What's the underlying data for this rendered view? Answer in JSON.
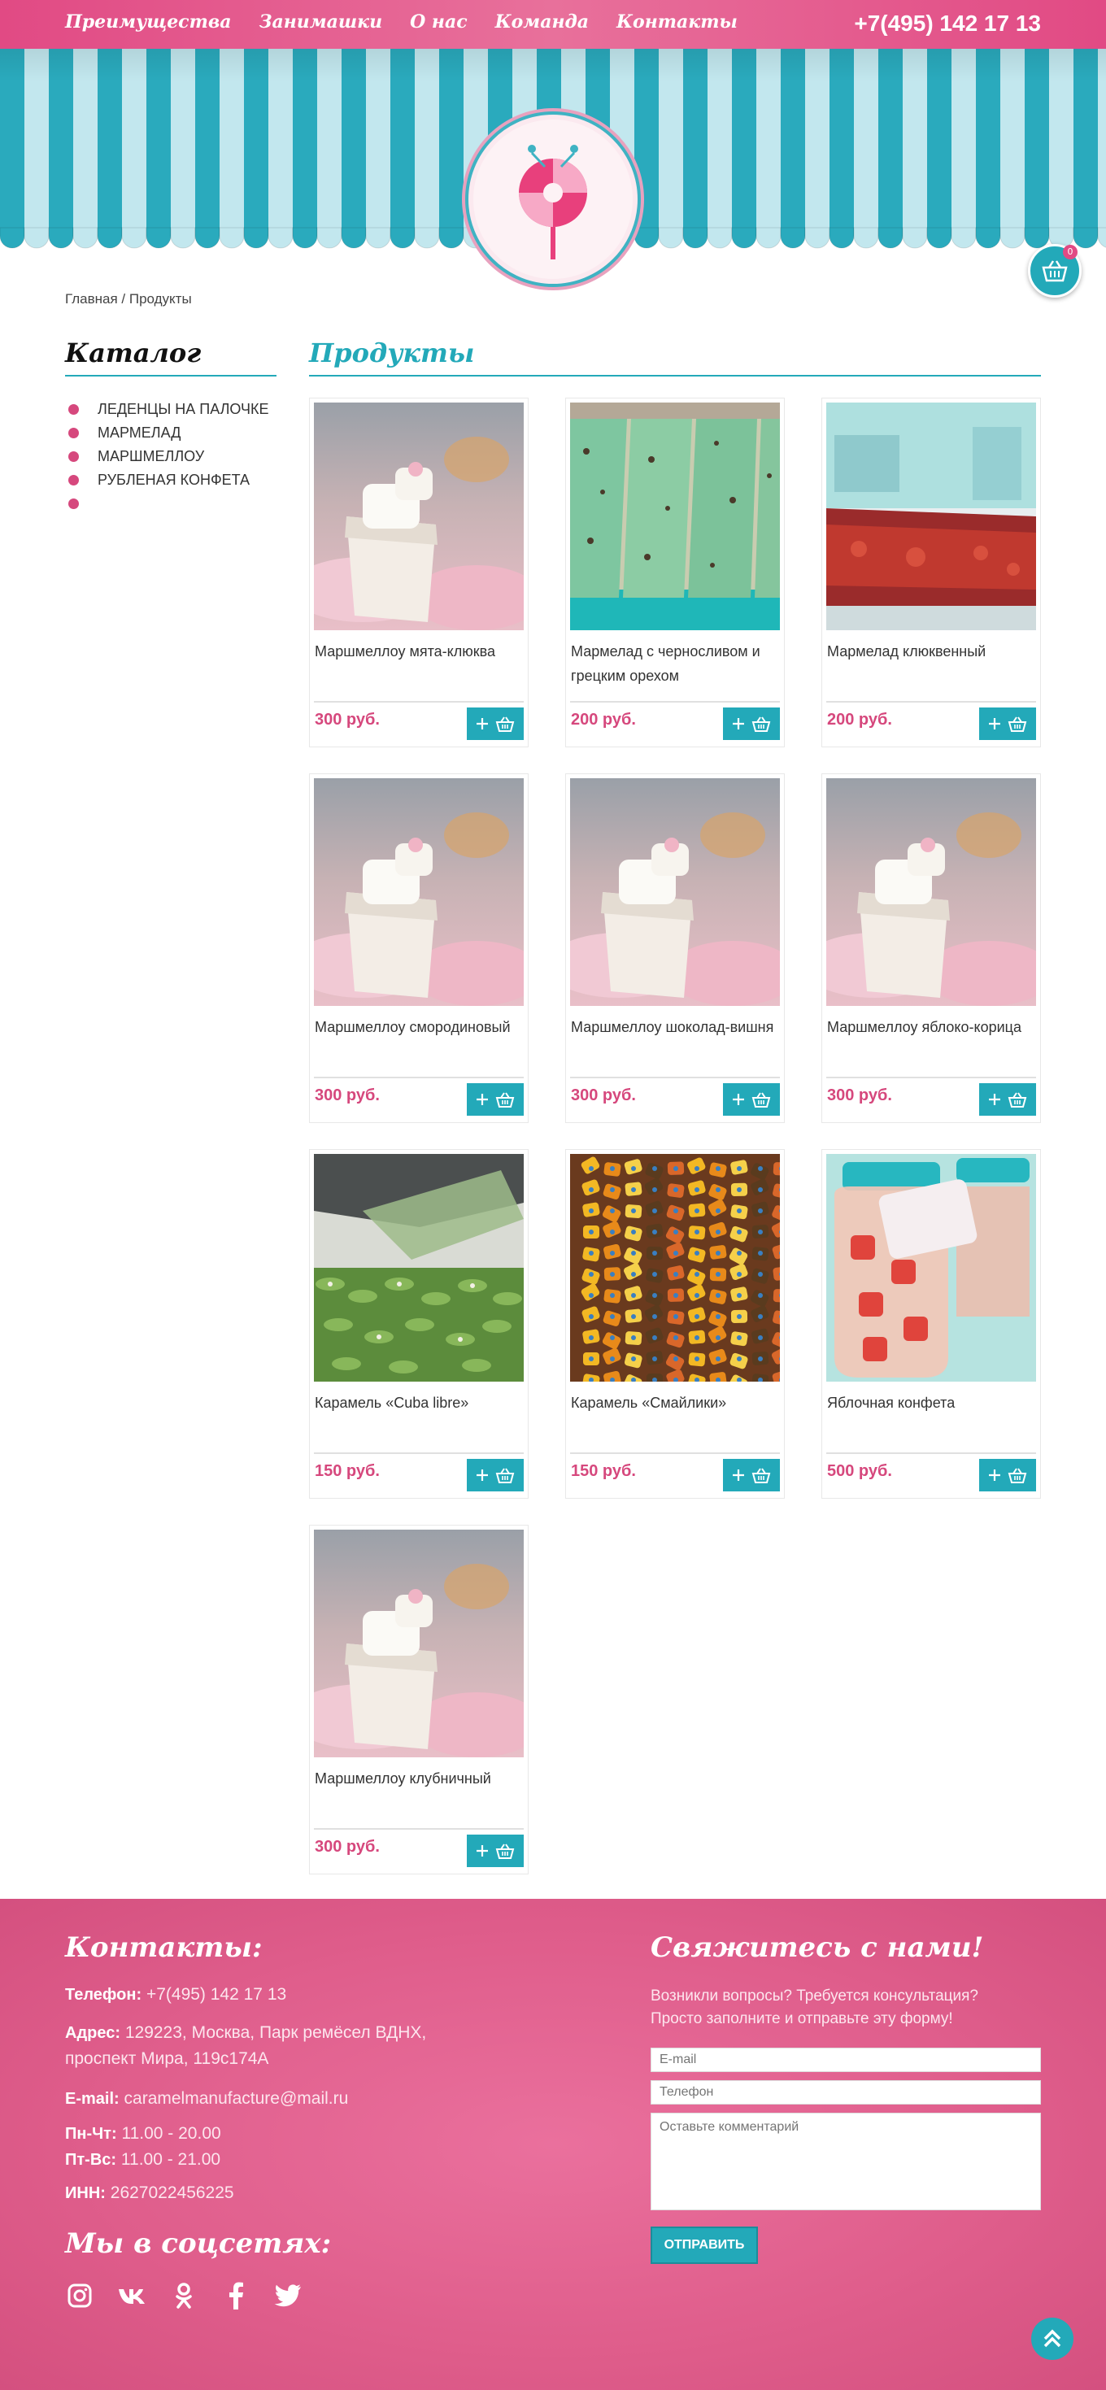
{
  "header": {
    "nav": [
      "Преимущества",
      "Занимашки",
      "О нас",
      "Команда",
      "Контакты"
    ],
    "phone": "+7(495) 142 17 13",
    "cart_count": "0"
  },
  "breadcrumb": "Главная / Продукты",
  "sidebar": {
    "title": "Каталог",
    "items": [
      "ЛЕДЕНЦЫ НА ПАЛОЧКЕ",
      "МАРМЕЛАД",
      "МАРШМЕЛЛОУ",
      "РУБЛЕНАЯ КОНФЕТА",
      ""
    ]
  },
  "main": {
    "title": "Продукты",
    "products": [
      {
        "name": "Маршмеллоу мята-клюква",
        "price": "300 руб.",
        "image": "marshmallow"
      },
      {
        "name": "Мармелад с черносливом и грецким орехом",
        "price": "200 руб.",
        "image": "marmalade-green"
      },
      {
        "name": "Мармелад клюквенный",
        "price": "200 руб.",
        "image": "marmalade-red"
      },
      {
        "name": "Маршмеллоу смородиновый",
        "price": "300 руб.",
        "image": "marshmallow"
      },
      {
        "name": "Маршмеллоу шоколад-вишня",
        "price": "300 руб.",
        "image": "marshmallow"
      },
      {
        "name": "Маршмеллоу яблоко-корица",
        "price": "300 руб.",
        "image": "marshmallow"
      },
      {
        "name": "Карамель «Cuba libre»",
        "price": "150 руб.",
        "image": "caramel-green"
      },
      {
        "name": "Карамель «Смайлики»",
        "price": "150 руб.",
        "image": "caramel-smileys"
      },
      {
        "name": "Яблочная конфета",
        "price": "500 руб.",
        "image": "candy-jar"
      },
      {
        "name": "Маршмеллоу клубничный",
        "price": "300 руб.",
        "image": "marshmallow"
      }
    ]
  },
  "footer": {
    "contacts_title": "Контакты:",
    "phone_label": "Телефон:",
    "phone": "+7(495) 142 17 13",
    "address_label": "Адрес:",
    "address_1": "129223, Москва, Парк ремёсел ВДНХ,",
    "address_2": "проспект Мира, 119с174А",
    "email_label": "E-mail:",
    "email": "caramelmanufacture@mail.ru",
    "hours_1_label": "Пн-Чт:",
    "hours_1": "11.00 - 20.00",
    "hours_2_label": "Пт-Вс:",
    "hours_2": "11.00 - 21.00",
    "inn_label": "ИНН:",
    "inn": "2627022456225",
    "social_title": "Мы в соцсетях:",
    "social_icons": [
      "instagram-icon",
      "vk-icon",
      "odnoklassniki-icon",
      "facebook-icon",
      "twitter-icon"
    ],
    "form_title": "Свяжитесь с нами!",
    "form_text_1": "Возникли вопросы? Требуется консультация?",
    "form_text_2": "Просто заполните и отправьте эту форму!",
    "email_placeholder": "E-mail",
    "phone_placeholder": "Телефон",
    "comment_placeholder": "Оставьте комментарий",
    "send_label": "ОТПРАВИТЬ"
  },
  "colors": {
    "pink": "#e14a84",
    "teal": "#23a9b9",
    "price": "#d6487d",
    "light_teal": "#bfe5ec"
  }
}
